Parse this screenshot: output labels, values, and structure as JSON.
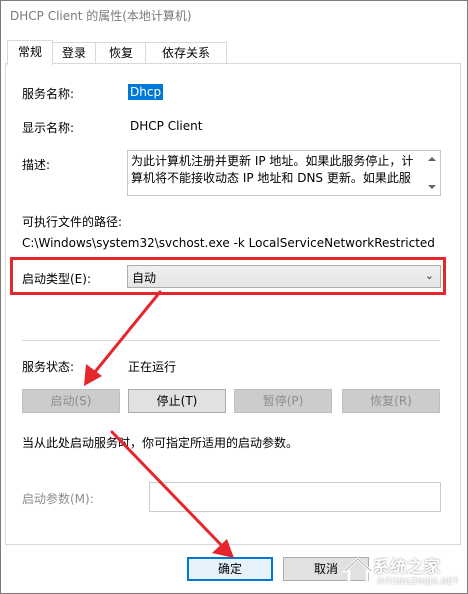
{
  "window": {
    "title": "DHCP Client 的属性(本地计算机)"
  },
  "tabs": [
    {
      "label": "常规",
      "active": true
    },
    {
      "label": "登录",
      "active": false
    },
    {
      "label": "恢复",
      "active": false
    },
    {
      "label": "依存关系",
      "active": false
    }
  ],
  "general": {
    "service_name_label": "服务名称:",
    "service_name_value": "Dhcp",
    "display_name_label": "显示名称:",
    "display_name_value": "DHCP Client",
    "description_label": "描述:",
    "description_value": "为此计算机注册并更新 IP 地址。如果此服务停止，计算机将不能接收动态 IP 地址和 DNS 更新。如果此服",
    "exe_path_label": "可执行文件的路径:",
    "exe_path_value": "C:\\Windows\\system32\\svchost.exe -k LocalServiceNetworkRestricted",
    "startup_type_label": "启动类型(E):",
    "startup_type_value": "自动",
    "service_status_label": "服务状态:",
    "service_status_value": "正在运行",
    "buttons": {
      "start": "启动(S)",
      "stop": "停止(T)",
      "pause": "暂停(P)",
      "resume": "恢复(R)"
    },
    "hint": "当从此处启动服务时，你可指定所适用的启动参数。",
    "start_params_label": "启动参数(M):",
    "start_params_value": ""
  },
  "footer": {
    "ok": "确定",
    "cancel": "取消"
  },
  "watermark": {
    "brand": "系统之家",
    "site": "XITONGZHIJIA.NET"
  },
  "colors": {
    "highlight": "#0078d7",
    "annotation": "#e5262d"
  }
}
